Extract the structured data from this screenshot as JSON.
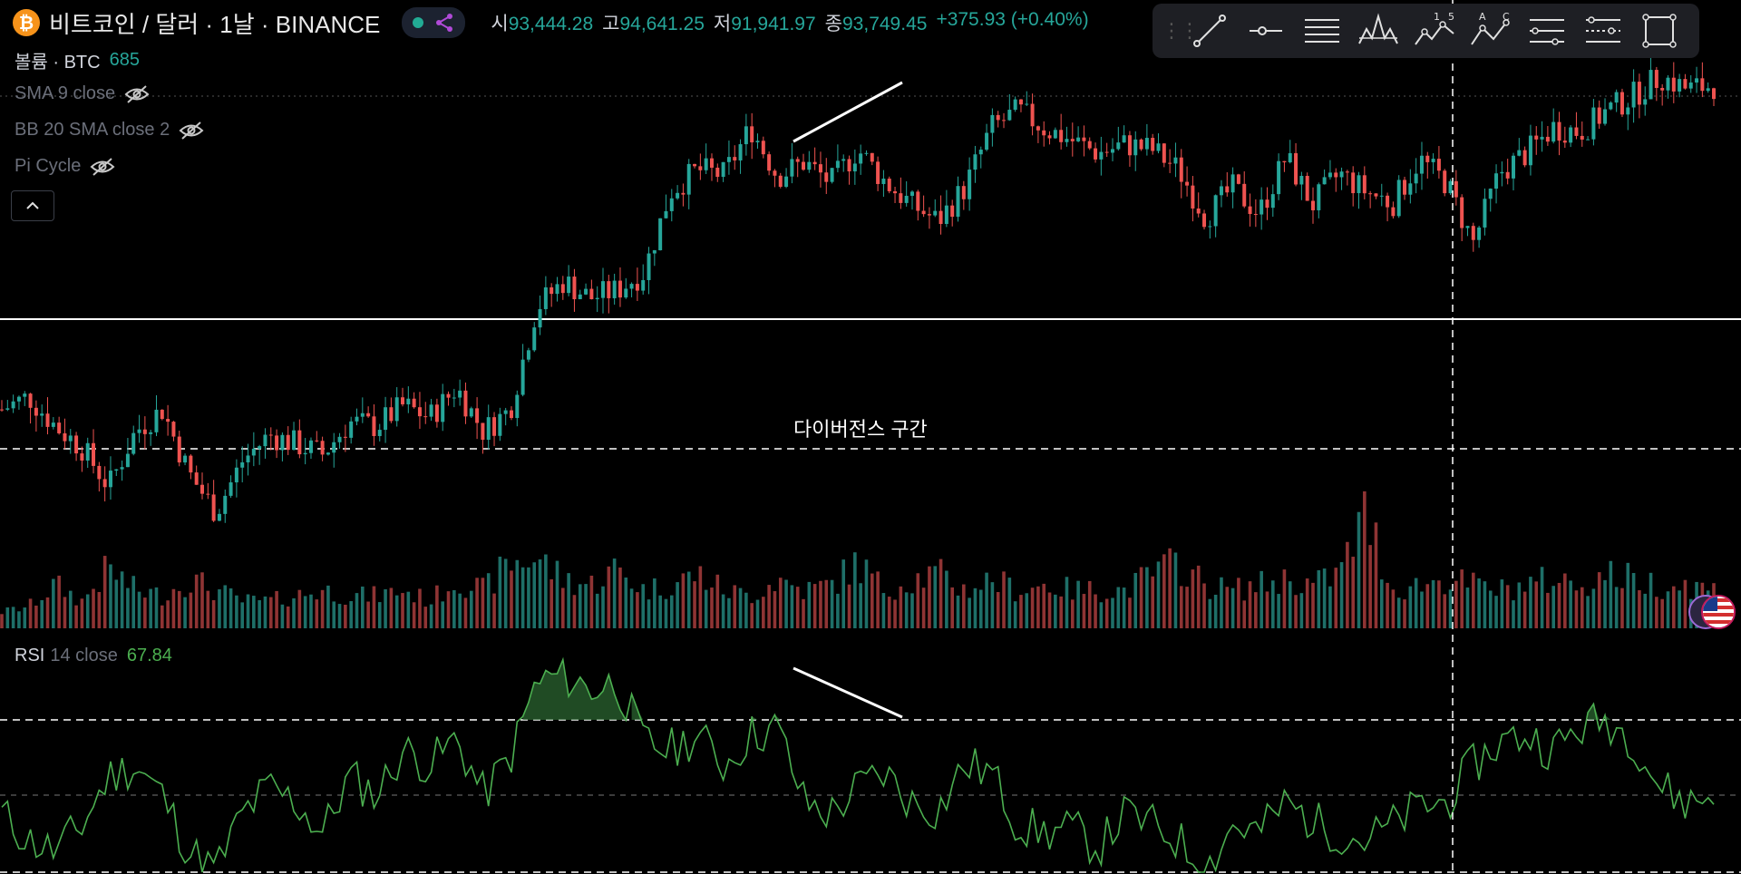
{
  "header": {
    "coin_glyph": "₿",
    "title": "비트코인 / 달러 · 1날 · BINANCE",
    "ohlc": [
      {
        "label": "시",
        "value": "93,444.28"
      },
      {
        "label": "고",
        "value": "94,641.25"
      },
      {
        "label": "저",
        "value": "91,941.97"
      },
      {
        "label": "종",
        "value": "93,749.45"
      }
    ],
    "change": "+375.93 (+0.40%)"
  },
  "legends": {
    "volume_label": "볼륨 · BTC",
    "volume_value": "685",
    "sma": "SMA 9 close",
    "bb": "BB 20 SMA close 2",
    "pi": "Pi Cycle",
    "rsi_label": "RSI",
    "rsi_params": "14 close",
    "rsi_value": "67.84"
  },
  "annotation": "다이버전스 구간",
  "toolbar": {
    "tools": [
      "trend-line-icon",
      "horizontal-ray-icon",
      "parallel-channel-icon",
      "head-shoulders-icon",
      "elliott-wave-icon",
      "abcd-pattern-icon",
      "fib-retracement-icon",
      "fib-extension-icon",
      "rectangle-icon"
    ],
    "wave_labels": [
      "1",
      "5"
    ],
    "abc_labels": [
      "A",
      "C"
    ]
  },
  "colors": {
    "up": "#26a69a",
    "down": "#ef5350",
    "rsi": "#4caf50",
    "background": "#000000"
  },
  "chart_data": {
    "type": "candlestick",
    "symbol": "BTCUSD",
    "exchange": "BINANCE",
    "interval": "1D",
    "close_path": [
      86500,
      87500,
      85200,
      83500,
      80500,
      84800,
      86500,
      81500,
      78500,
      82500,
      84500,
      83800,
      83000,
      85500,
      85200,
      86800,
      85900,
      88200,
      84800,
      86500,
      94500,
      96500,
      95200,
      95800,
      97200,
      103500,
      105200,
      104800,
      108500,
      104700,
      105800,
      104200,
      106800,
      104300,
      102500,
      101200,
      103800,
      108500,
      109800,
      108400,
      107500,
      106500,
      107200,
      106800,
      105200,
      101500,
      103800,
      101800,
      106200,
      102500,
      104900,
      103500,
      102600,
      106000,
      104200,
      99500,
      105000,
      106500,
      108500,
      108200,
      109800,
      111000,
      112500,
      111500,
      111800
    ],
    "volume_relative_path": [
      0.1,
      0.15,
      0.35,
      0.2,
      0.5,
      0.3,
      0.25,
      0.4,
      0.3,
      0.2,
      0.2,
      0.25,
      0.3,
      0.25,
      0.25,
      0.3,
      0.2,
      0.4,
      0.3,
      0.55,
      0.6,
      0.4,
      0.35,
      0.5,
      0.3,
      0.35,
      0.45,
      0.3,
      0.25,
      0.4,
      0.3,
      0.35,
      0.55,
      0.3,
      0.4,
      0.45,
      0.3,
      0.4,
      0.3,
      0.35,
      0.3,
      0.3,
      0.3,
      0.45,
      0.55,
      0.35,
      0.3,
      0.35,
      0.4,
      0.35,
      0.45,
      1.0,
      0.3,
      0.35,
      0.4,
      0.35,
      0.3,
      0.35,
      0.4,
      0.35,
      0.45,
      0.4,
      0.35,
      0.35,
      0.3
    ],
    "rsi_path": [
      45,
      38,
      35,
      42,
      55,
      58,
      50,
      35,
      30,
      45,
      52,
      48,
      40,
      55,
      50,
      62,
      58,
      65,
      50,
      60,
      80,
      82,
      78,
      80,
      64,
      62,
      66,
      58,
      66,
      68,
      48,
      45,
      52,
      56,
      48,
      46,
      58,
      56,
      42,
      40,
      41,
      36,
      45,
      42,
      38,
      30,
      42,
      40,
      48,
      43,
      40,
      38,
      42,
      47,
      48,
      58,
      64,
      66,
      62,
      68,
      70,
      65,
      52,
      48,
      50
    ],
    "levels": {
      "rsi_overbought": 70,
      "rsi_mid": 50
    },
    "drawings": {
      "price_divergence_line": "rising trend line between two price highs",
      "rsi_divergence_line": "falling trend line between two RSI highs"
    }
  }
}
